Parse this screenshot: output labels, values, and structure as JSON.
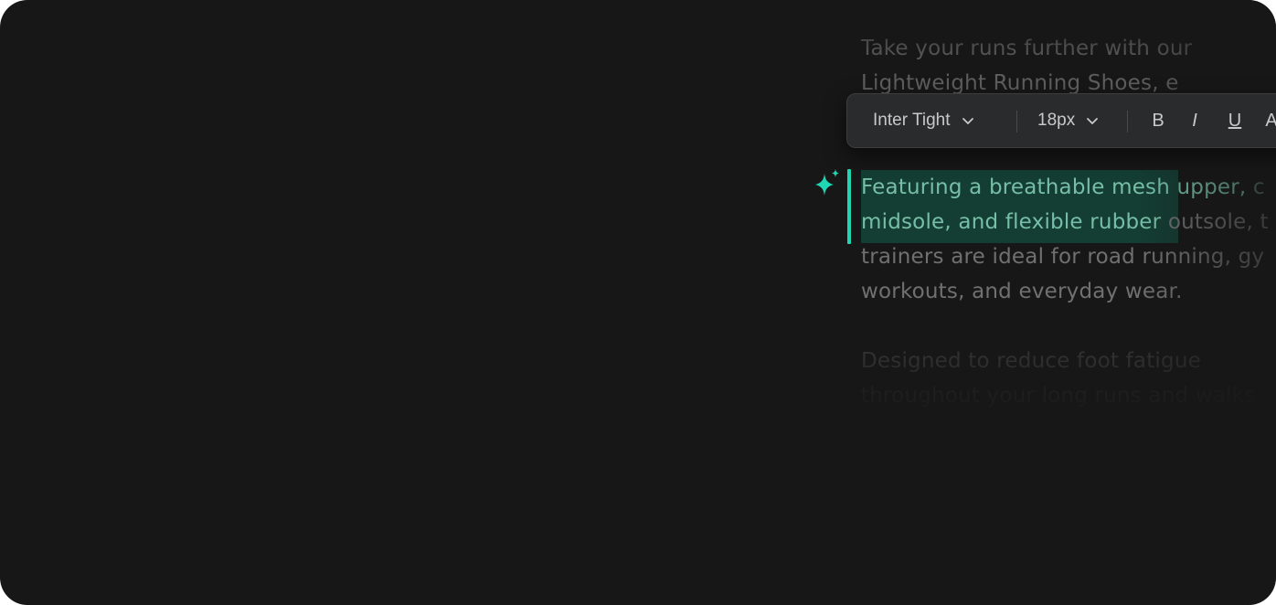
{
  "toolbar": {
    "font_family": "Inter Tight",
    "font_size": "18px",
    "bold_label": "B",
    "italic_label": "I",
    "underline_label": "U",
    "text_color_label": "A"
  },
  "editor": {
    "intro_lines": [
      "Take your runs further with our",
      "Lightweight Running Shoes, e"
    ],
    "selected_lines": [
      {
        "selected": "Featuring a breathable mesh upper,",
        "rest": " c"
      },
      {
        "selected": "midsole, and flexible rubber",
        "rest": " outsole, t"
      }
    ],
    "body_lines": [
      "trainers are ideal for road running, gy",
      "workouts, and everyday wear."
    ],
    "next_paragraph": [
      "Designed to reduce foot fatigue",
      "throughout your long runs and walks"
    ]
  },
  "colors": {
    "background": "#171717",
    "accent": "#1fd8b3",
    "selection": "#143d33",
    "toolbar": "#2a2b2c"
  },
  "icons": {
    "ai": "sparkle-icon",
    "dropdown": "chevron-down-icon"
  }
}
